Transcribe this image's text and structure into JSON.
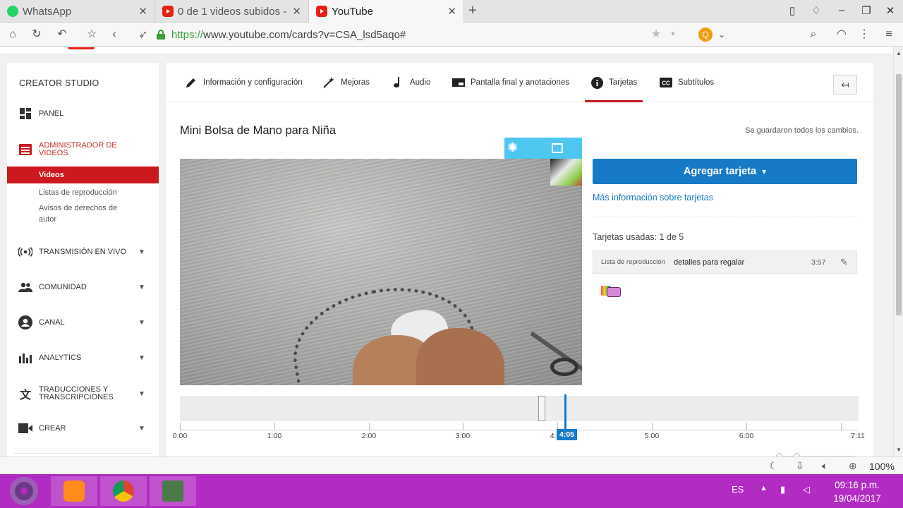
{
  "browser": {
    "tabs": [
      {
        "title": "WhatsApp",
        "icon": "whatsapp-icon",
        "active": false
      },
      {
        "title": "0 de 1 videos subidos -",
        "icon": "youtube-icon",
        "active": false
      },
      {
        "title": "YouTube",
        "icon": "youtube-icon",
        "active": true
      }
    ],
    "url_secure": "https://",
    "url_rest": "www.youtube.com/cards?v=CSA_lsd5aqo#",
    "zoom": "100%"
  },
  "sidebar": {
    "title": "CREATOR STUDIO",
    "items": [
      {
        "label": "PANEL",
        "icon": "dashboard-icon"
      },
      {
        "label": "ADMINISTRADOR DE VIDEOS",
        "icon": "video-manager-icon"
      },
      {
        "label": "TRANSMISIÓN EN VIVO",
        "icon": "live-icon"
      },
      {
        "label": "COMUNIDAD",
        "icon": "community-icon"
      },
      {
        "label": "CANAL",
        "icon": "channel-icon"
      },
      {
        "label": "ANALYTICS",
        "icon": "analytics-icon"
      },
      {
        "label": "TRADUCCIONES Y TRANSCRIPCIONES",
        "icon": "translate-icon"
      },
      {
        "label": "CREAR",
        "icon": "create-icon"
      }
    ],
    "subitems": [
      {
        "label": "Videos",
        "active": true
      },
      {
        "label": "Listas de reproducción",
        "active": false
      },
      {
        "label": "Avisos de derechos de autor",
        "active": false
      }
    ]
  },
  "editor": {
    "tabs": [
      {
        "label": "Información y configuración",
        "icon": "pencil-icon"
      },
      {
        "label": "Mejoras",
        "icon": "magic-wand-icon"
      },
      {
        "label": "Audio",
        "icon": "music-note-icon"
      },
      {
        "label": "Pantalla final y anotaciones",
        "icon": "end-screen-icon"
      },
      {
        "label": "Tarjetas",
        "icon": "info-icon",
        "active": true
      },
      {
        "label": "Subtítulos",
        "icon": "cc-icon"
      }
    ],
    "video_title": "Mini Bolsa de Mano para Niña",
    "save_status": "Se guardaron todos los cambios.",
    "add_card_label": "Agregar tarjeta",
    "more_info_link": "Más información sobre tarjetas",
    "cards_used": "Tarjetas usadas: 1 de 5",
    "card": {
      "type": "Lista de reproducción",
      "name": "detalles para regalar",
      "time": "3:57"
    }
  },
  "timeline": {
    "ticks": [
      "0:00",
      "1:00",
      "2:00",
      "3:00",
      "4:00",
      "5:00",
      "6:00",
      "7:11"
    ],
    "current_time": "4:05"
  },
  "taskbar": {
    "language": "ES",
    "time": "09:16 p.m.",
    "date": "19/04/2017"
  },
  "colors": {
    "accent_blue": "#167ac6",
    "youtube_red": "#cc181e",
    "taskbar": "#b22cc4"
  }
}
